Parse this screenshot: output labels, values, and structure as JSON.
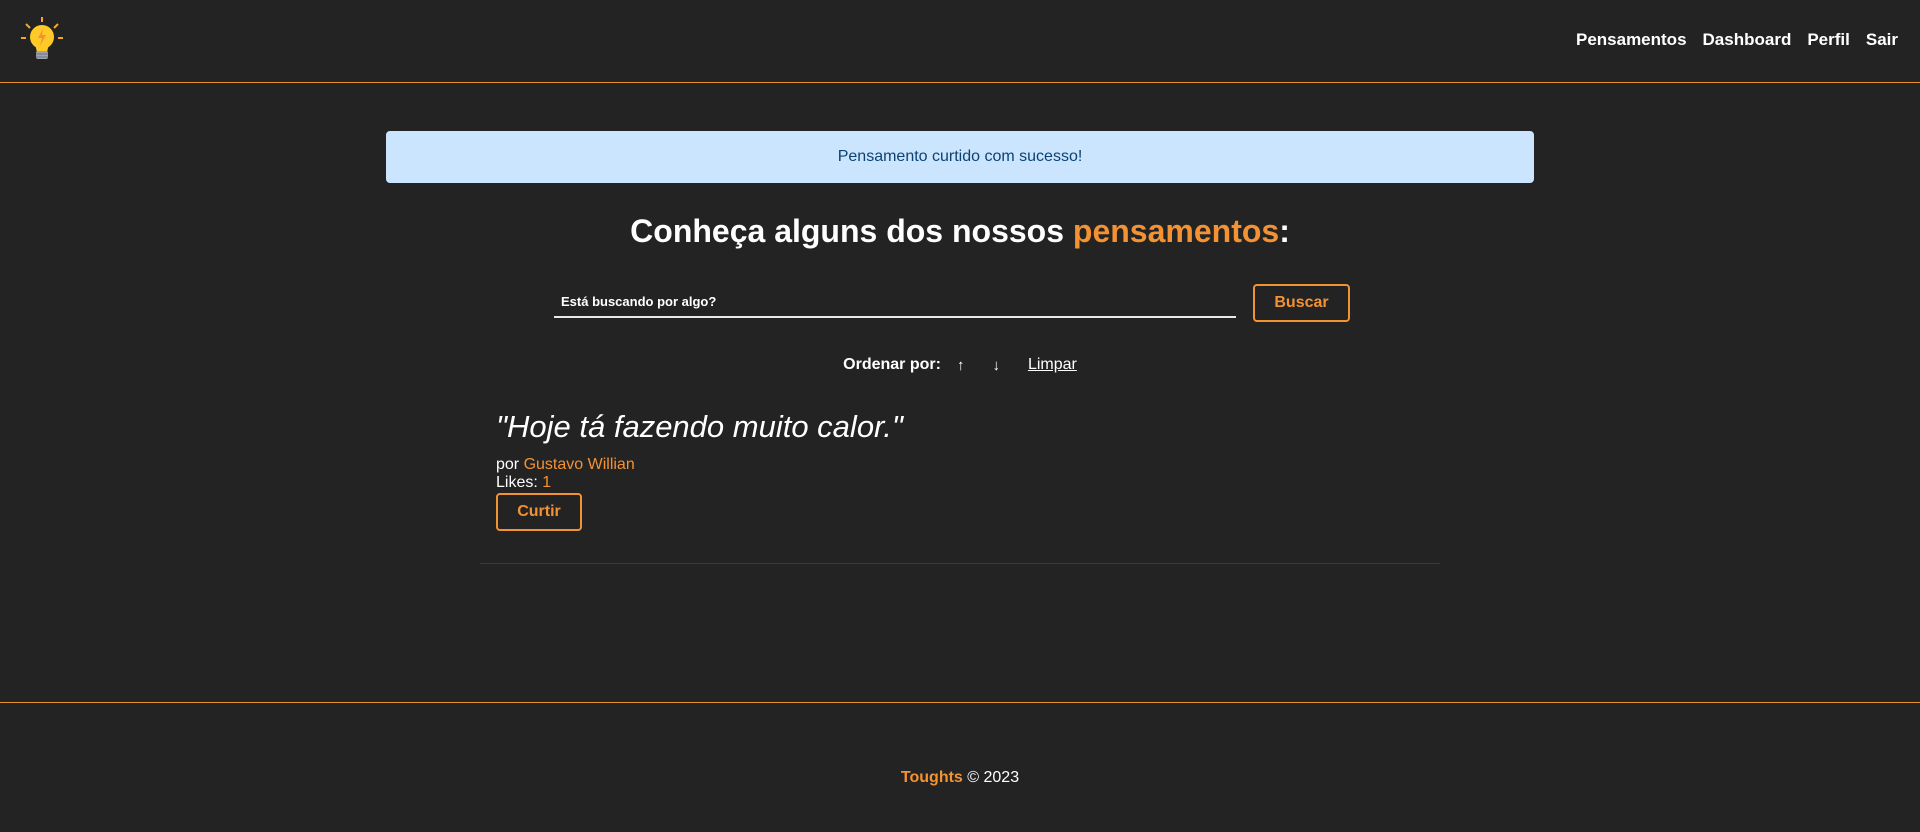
{
  "nav": {
    "logo": "lightbulb-icon",
    "links": [
      "Pensamentos",
      "Dashboard",
      "Perfil",
      "Sair"
    ]
  },
  "flash": {
    "message": "Pensamento curtido com sucesso!"
  },
  "heading": {
    "prefix": "Conheça alguns dos nossos ",
    "accent": "pensamentos",
    "suffix": ":"
  },
  "search": {
    "placeholder": "Está buscando por algo?",
    "button": "Buscar"
  },
  "order": {
    "label": "Ordenar por:",
    "asc": "↑",
    "desc": "↓",
    "clear": "Limpar"
  },
  "thoughts": [
    {
      "text": "\"Hoje tá fazendo muito calor.\"",
      "author_prefix": "por ",
      "author": "Gustavo Willian",
      "likes_label": "Likes: ",
      "likes": "1",
      "like_button": "Curtir"
    }
  ],
  "footer": {
    "brand": "Toughts",
    "copyright": " © 2023"
  },
  "colors": {
    "accent": "#f39233",
    "background": "#232323",
    "flash_bg": "#cce5ff",
    "flash_text": "#0b4272"
  }
}
